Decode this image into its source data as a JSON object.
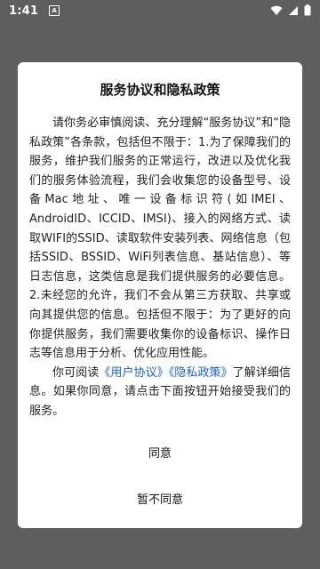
{
  "status_bar": {
    "time": "1:41",
    "notification_icon_label": "A"
  },
  "dialog": {
    "title": "服务协议和隐私政策",
    "paragraph1": "请你务必审慎阅读、充分理解“服务协议”和“隐私政策”各条款，包括但不限于：1.为了保障我们的服务，维护我们服务的正常运行，改进以及优化我们的服务体验流程，我们会收集您的设备型号、设备Mac地址、唯一设备标识符(如IMEI、AndroidID、ICCID、IMSI)、接入的网络方式、读取WIFI的SSID、读取软件安装列表、网络信息（包括SSID、BSSID、WiFi列表信息、基站信息）、等日志信息，这类信息是我们提供服务的必要信息。2.未经您的允许，我们不会从第三方获取、共享或向其提供您的信息。包括但不限于：为了更好的向你提供服务，我们需要收集你的设备标识、操作日志等信息用于分析、优化应用性能。",
    "paragraph2_prefix": "你可阅读",
    "user_agreement_link": "《用户协议》",
    "privacy_policy_link": "《隐私政策》",
    "paragraph2_suffix": "了解详细信息。如果你同意，请点击下面按钮开始接受我们的服务。",
    "agree_label": "同意",
    "disagree_label": "暂不同意"
  },
  "colors": {
    "overlay": "#5e5e5e",
    "dialog_bg": "#ffffff",
    "link": "#1a5fd6"
  }
}
